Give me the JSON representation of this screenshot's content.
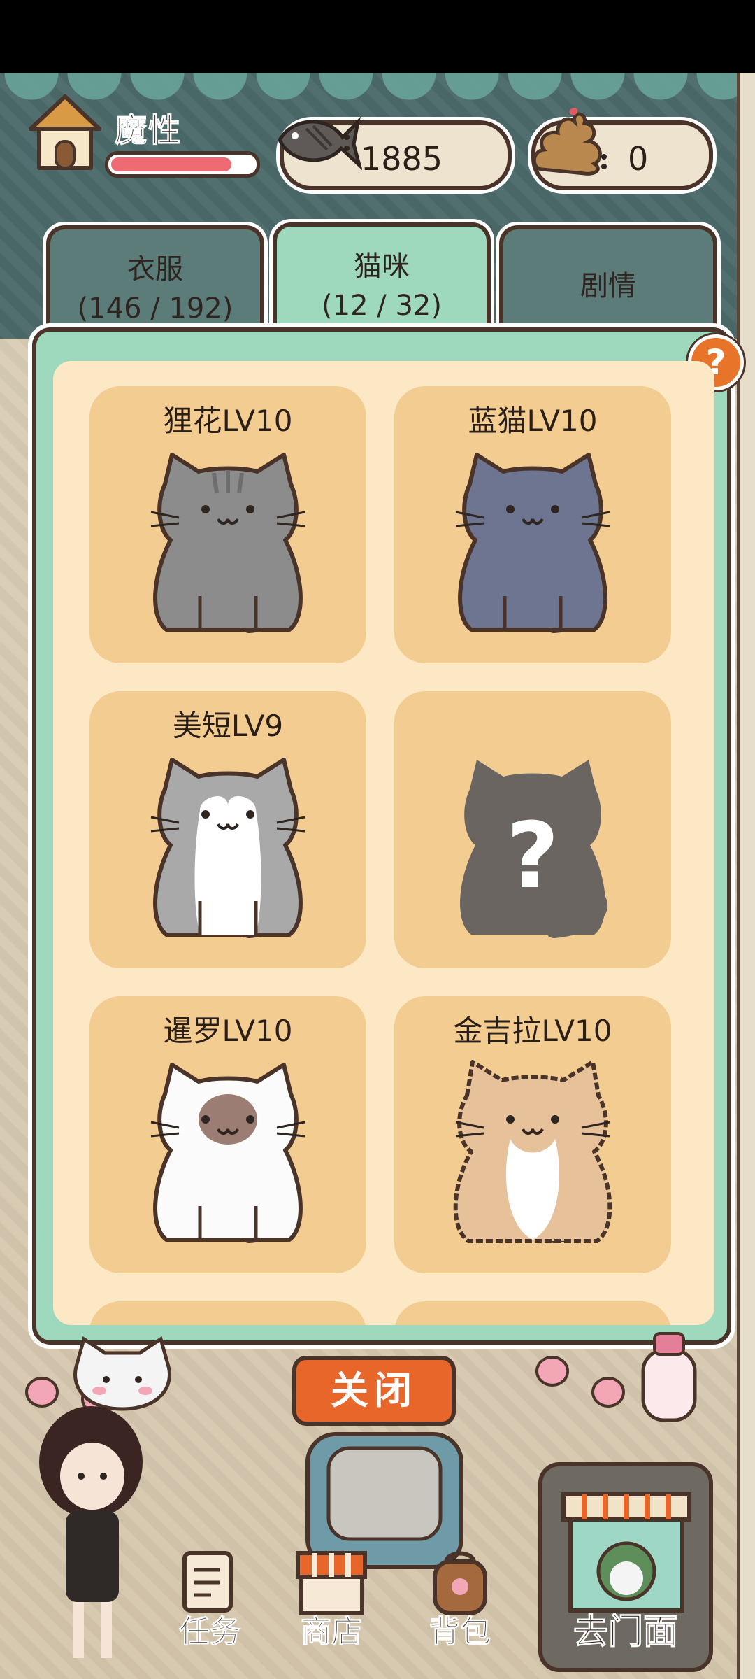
{
  "hud": {
    "player_name": "魔性",
    "hp_fraction": 0.88,
    "fish_value": "1885",
    "poop_value": "0"
  },
  "tabs": [
    {
      "name": "衣服",
      "count": "(146 / 192)",
      "active": false
    },
    {
      "name": "猫咪",
      "count": "(12 / 32)",
      "active": true
    },
    {
      "name": "剧情",
      "count": "",
      "active": false
    }
  ],
  "help": {
    "label": "?"
  },
  "cards": [
    {
      "name": "狸花LV10",
      "cat": "tabby-gray"
    },
    {
      "name": "蓝猫LV10",
      "cat": "blue-gray"
    },
    {
      "name": "美短LV9",
      "cat": "american-shorthair"
    },
    {
      "name": "",
      "cat": "unknown-silhouette"
    },
    {
      "name": "暹罗LV10",
      "cat": "siamese"
    },
    {
      "name": "金吉拉LV10",
      "cat": "chinchilla"
    }
  ],
  "close_button": "关闭",
  "nav": {
    "tasks": "任务",
    "shop": "商店",
    "bag": "背包",
    "go_storefront": "去门面"
  },
  "colors": {
    "accent_orange": "#e8662a",
    "panel_green": "#9fd9bd",
    "card_tan": "#f2cc91",
    "outline_brown": "#4a3328"
  }
}
